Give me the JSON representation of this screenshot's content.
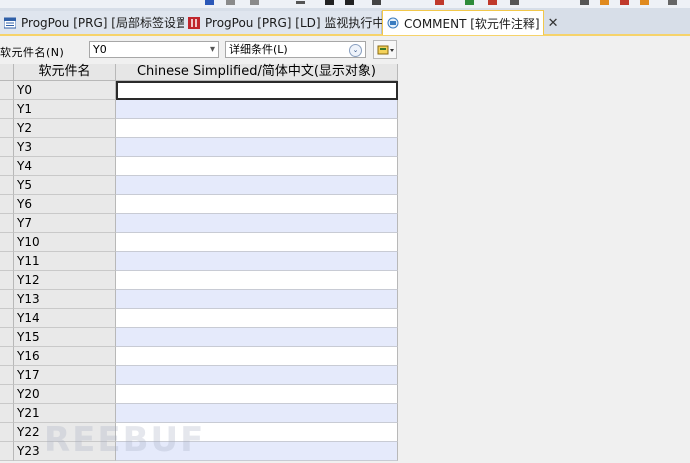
{
  "tabs": [
    {
      "label": "ProgPou [PRG] [局部标签设置]",
      "icon": "program-local-label-icon"
    },
    {
      "label": "ProgPou [PRG] [LD] 监视执行中...",
      "icon": "ladder-monitor-icon"
    },
    {
      "label": "COMMENT [软元件注释]",
      "icon": "comment-icon",
      "active": true
    }
  ],
  "tab_close_glyph": "✕",
  "filter": {
    "device_label": "软元件名(N)",
    "device_value": "Y0",
    "detail_label": "详细条件(L)"
  },
  "table": {
    "col_device": "软元件名",
    "col_comment": "Chinese Simplified/简体中文(显示对象)",
    "rows": [
      "Y0",
      "Y1",
      "Y2",
      "Y3",
      "Y4",
      "Y5",
      "Y6",
      "Y7",
      "Y10",
      "Y11",
      "Y12",
      "Y13",
      "Y14",
      "Y15",
      "Y16",
      "Y17",
      "Y20",
      "Y21",
      "Y22",
      "Y23"
    ]
  },
  "watermark": "REEBUF",
  "colors": {
    "tab_accent": "#f6d36a",
    "odd_row": "#e5eafb",
    "header_bg": "#e6e6e6"
  }
}
